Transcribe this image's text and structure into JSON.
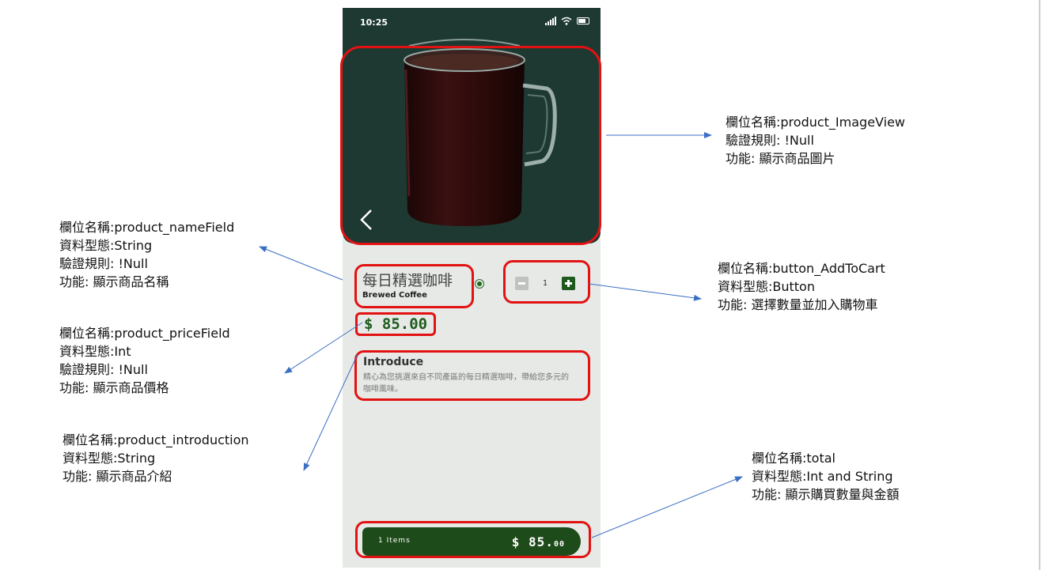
{
  "phone": {
    "status_time": "10:25",
    "status_icons": [
      "signal-icon",
      "wifi-icon",
      "battery-icon"
    ],
    "product": {
      "name_cn": "每日精選咖啡",
      "name_en": "Brewed Coffee",
      "price": "$ 85.00",
      "quantity": "1",
      "intro_title": "Introduce",
      "intro_text": "精心為您挑選來自不同產區的每日精選咖啡，帶給您多元的咖啡風味。"
    },
    "total": {
      "items": "1 Items",
      "price_main": "$ 85.",
      "price_cents": "00"
    }
  },
  "annotations": {
    "image_view": [
      "欄位名稱:product_ImageView",
      "驗證規則: !Null",
      "功能: 顯示商品圖片"
    ],
    "name_field": [
      "欄位名稱:product_nameField",
      "資料型態:String",
      "驗證規則: !Null",
      "功能: 顯示商品名稱"
    ],
    "price_field": [
      "欄位名稱:product_priceField",
      "資料型態:Int",
      "驗證規則: !Null",
      "功能: 顯示商品價格"
    ],
    "introduction": [
      "欄位名稱:product_introduction",
      "資料型態:String",
      "功能: 顯示商品介紹"
    ],
    "add_to_cart": [
      "欄位名稱:button_AddToCart",
      "資料型態:Button",
      "功能: 選擇數量並加入購物車"
    ],
    "total": [
      "欄位名稱:total",
      "資料型態:Int and String",
      "功能: 顯示購買數量與金額"
    ]
  },
  "colors": {
    "hero_bg": "#1d3932",
    "accent_green": "#1e5a1e",
    "highlight_red": "#e31212",
    "arrow_blue": "#3b6fc4"
  }
}
